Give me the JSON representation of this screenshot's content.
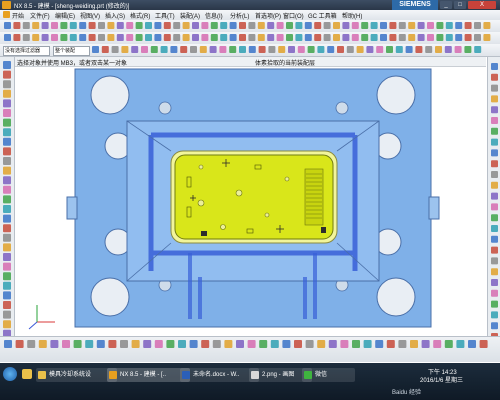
{
  "window": {
    "title": "NX 8.5 - 建模 - [sheng-weiding.prt (修改的)]",
    "brand": "SIEMENS",
    "minimize": "_",
    "restore": "□",
    "close": "X"
  },
  "menu": {
    "start": "开始",
    "items": [
      "文件(F)",
      "编辑(E)",
      "视图(V)",
      "插入(S)",
      "格式(R)",
      "工具(T)",
      "装配(A)",
      "信息(I)",
      "分析(L)",
      "首选项(P)",
      "窗口(O)",
      "GC 工具箱",
      "帮助(H)"
    ]
  },
  "toolbar": {
    "filter_select": "没有选择过滤器",
    "scope_select": "整个装配"
  },
  "cue_line": {
    "prompt": "选择对象并使用 MB3，或者双击某一对象",
    "status": "体素拾取的当前装配层"
  },
  "colors": {
    "mold_plate": "#7fb0e8",
    "pocket": "#f2f59a",
    "core_part": "#d9e61a",
    "channel": "#3860d8",
    "titlebar": "#2a3748",
    "taskbar": "#0f1a26"
  },
  "icons": [
    "cut-tool-icon",
    "cursor-icon",
    "gear-icon",
    "line-icon",
    "color-icon",
    "orient-icon"
  ],
  "taskbar": {
    "items": [
      {
        "label": "模具冷却系统设",
        "icon": "folder-icon"
      },
      {
        "label": "NX 8.5 - 建模 - [..",
        "icon": "nx-icon"
      },
      {
        "label": "未命名.docx - W..",
        "icon": "word-icon"
      },
      {
        "label": "2.png - 画图",
        "icon": "paint-icon"
      },
      {
        "label": "微信",
        "icon": "wechat-icon"
      }
    ],
    "clock": "下午 14:23",
    "date": "2016/1/6 星期三",
    "watermark": "Baidu 经验"
  }
}
